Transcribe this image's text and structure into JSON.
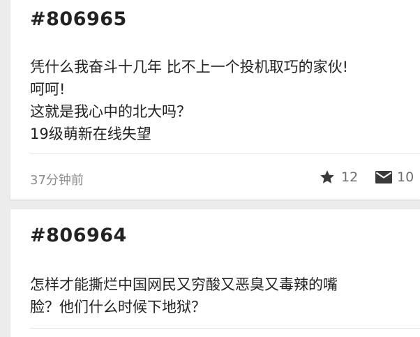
{
  "posts": [
    {
      "id": "#806965",
      "lines": [
        "凭什么我奋斗十几年 比不上一个投机取巧的家伙!",
        "呵呵!",
        "这就是我心中的北大吗？",
        "19级萌新在线失望"
      ],
      "time": "37分钟前",
      "likes": "12",
      "comments": "10",
      "icons": {
        "likes": "star-icon",
        "comments": "mail-icon"
      }
    },
    {
      "id": "#806964",
      "lines": [
        "怎样才能撕烂中国网民又穷酸又恶臭又毒辣的嘴",
        "脸？他们什么时候下地狱？"
      ]
    }
  ],
  "colors": {
    "background": "#ececec",
    "card": "#ffffff",
    "text": "#222222",
    "meta": "#8c8c8c",
    "icon": "#3a3a3a"
  }
}
